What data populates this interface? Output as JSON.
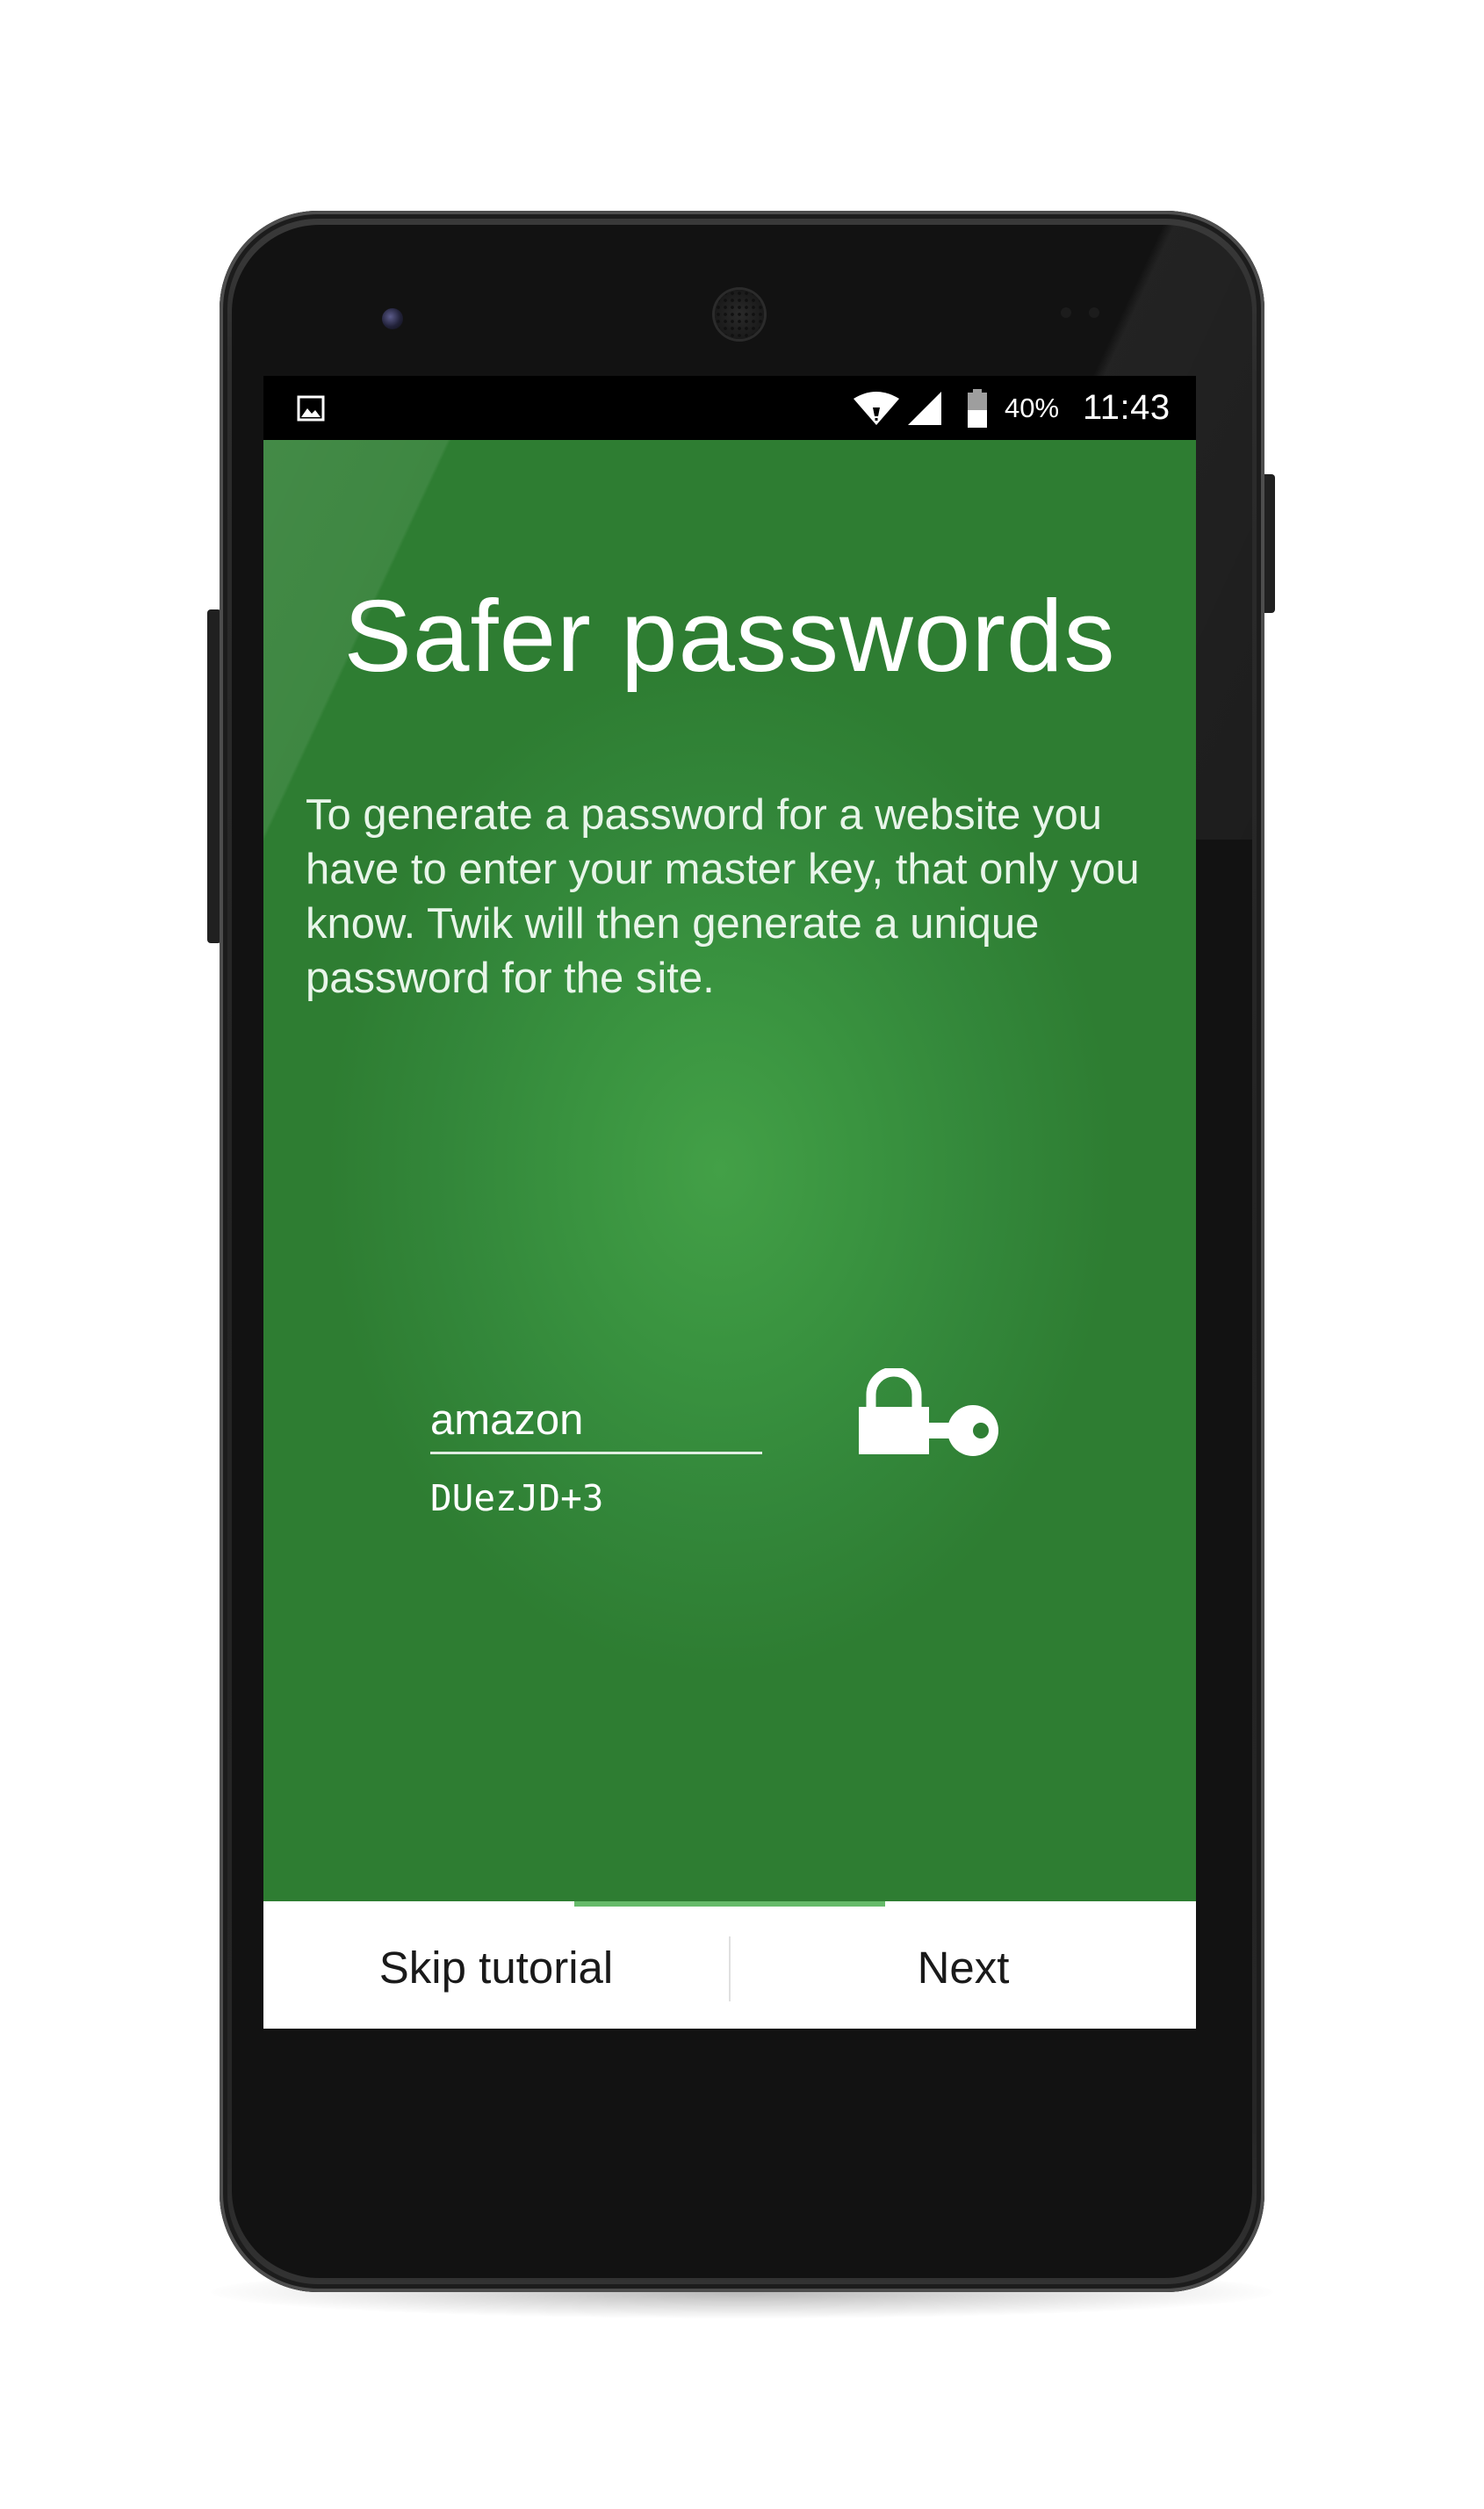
{
  "status_bar": {
    "battery": "40%",
    "time": "11:43",
    "icons": [
      "image-notification-icon",
      "wifi-icon",
      "cell-signal-icon",
      "battery-icon"
    ]
  },
  "tutorial": {
    "title": "Safer passwords",
    "description": "To generate a password for a website you have to enter your master key, that only you know. Twik will then generate a unique password for the site.",
    "site_value": "amazon",
    "generated_password": "DUezJD+3",
    "illustration_icon": "lock-key-icon"
  },
  "footer": {
    "skip_label": "Skip tutorial",
    "next_label": "Next",
    "page_progress": {
      "current": 2,
      "total": 3
    }
  },
  "colors": {
    "primary_green": "#2e7d32",
    "highlight_green": "#43a047",
    "progress_green": "#66bb6a",
    "status_bar": "#000000",
    "footer_bg": "#ffffff"
  }
}
